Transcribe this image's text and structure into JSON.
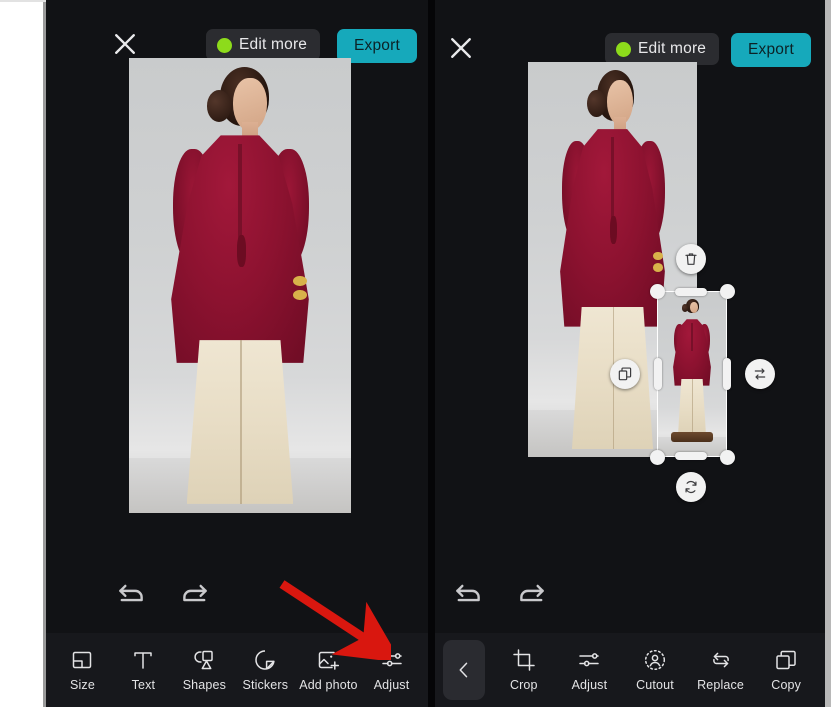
{
  "app": {
    "theme_bg": "#111215",
    "toolbar_bg": "#17181c",
    "accent_teal": "#16a9bb",
    "accent_green": "#8ddb1b",
    "annotation_color": "#d9170f"
  },
  "panels": [
    {
      "id": "left",
      "header": {
        "close_icon": "close-icon",
        "edit_more_label": "Edit more",
        "edit_more_dot_color": "#8ddb1b",
        "export_label": "Export"
      },
      "history": {
        "undo_icon": "undo-icon",
        "redo_icon": "redo-icon"
      },
      "toolbar": [
        {
          "label": "Size",
          "icon": "size-icon"
        },
        {
          "label": "Text",
          "icon": "text-icon"
        },
        {
          "label": "Shapes",
          "icon": "shapes-icon"
        },
        {
          "label": "Stickers",
          "icon": "stickers-icon"
        },
        {
          "label": "Add photo",
          "icon": "add-photo-icon"
        },
        {
          "label": "Adjust",
          "icon": "adjust-icon"
        }
      ],
      "annotation": {
        "type": "arrow",
        "points_at": "Add photo",
        "color": "#d9170f"
      }
    },
    {
      "id": "right",
      "header": {
        "close_icon": "close-icon",
        "edit_more_label": "Edit more",
        "edit_more_dot_color": "#8ddb1b",
        "export_label": "Export"
      },
      "history": {
        "undo_icon": "undo-icon",
        "redo_icon": "redo-icon"
      },
      "selection": {
        "delete_icon": "trash-icon",
        "duplicate_icon": "duplicate-icon",
        "flip_icon": "flip-horizontal-icon",
        "rotate_icon": "rotate-icon"
      },
      "back_button": {
        "icon": "chevron-left-icon"
      },
      "toolbar": [
        {
          "label": "Crop",
          "icon": "crop-icon"
        },
        {
          "label": "Adjust",
          "icon": "adjust-icon"
        },
        {
          "label": "Cutout",
          "icon": "cutout-icon"
        },
        {
          "label": "Replace",
          "icon": "replace-icon"
        },
        {
          "label": "Copy",
          "icon": "copy-icon"
        }
      ]
    }
  ]
}
